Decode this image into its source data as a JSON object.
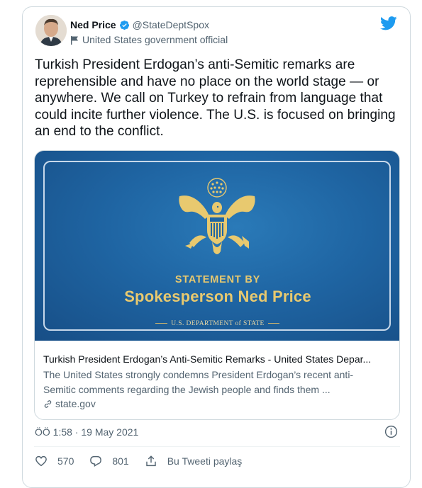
{
  "author": {
    "name": "Ned Price",
    "handle": "@StateDeptSpox",
    "label": "United States government official"
  },
  "tweet": {
    "text": "Turkish President Erdogan’s anti-Semitic remarks are reprehensible and have no place on the world stage — or anywhere. We call on Turkey to refrain from language that could incite further violence. The U.S. is focused on bringing an end to the conflict."
  },
  "link_card": {
    "image": {
      "heading_small": "STATEMENT BY",
      "heading_large": "Spokesperson Ned Price",
      "department": "U.S. DEPARTMENT of STATE"
    },
    "title": "Turkish President Erdogan’s Anti-Semitic Remarks - United States Depar...",
    "description": "The United States strongly condemns President Erdogan’s recent anti-Semitic comments regarding the Jewish people and finds them ...",
    "domain": "state.gov"
  },
  "timestamp": "ÖÖ 1:58 · 19 May 2021",
  "actions": {
    "likes": "570",
    "replies": "801",
    "share_label": "Bu Tweeti paylaş"
  },
  "colors": {
    "twitter_blue": "#1d9bf0",
    "image_blue": "#1f65a3",
    "gold": "#e8c96f",
    "secondary_text": "#536471"
  },
  "icons": [
    "verified-badge-icon",
    "government-flag-icon",
    "twitter-bird-icon",
    "eagle-seal-icon",
    "link-icon",
    "info-icon",
    "heart-icon",
    "reply-icon",
    "share-icon"
  ]
}
